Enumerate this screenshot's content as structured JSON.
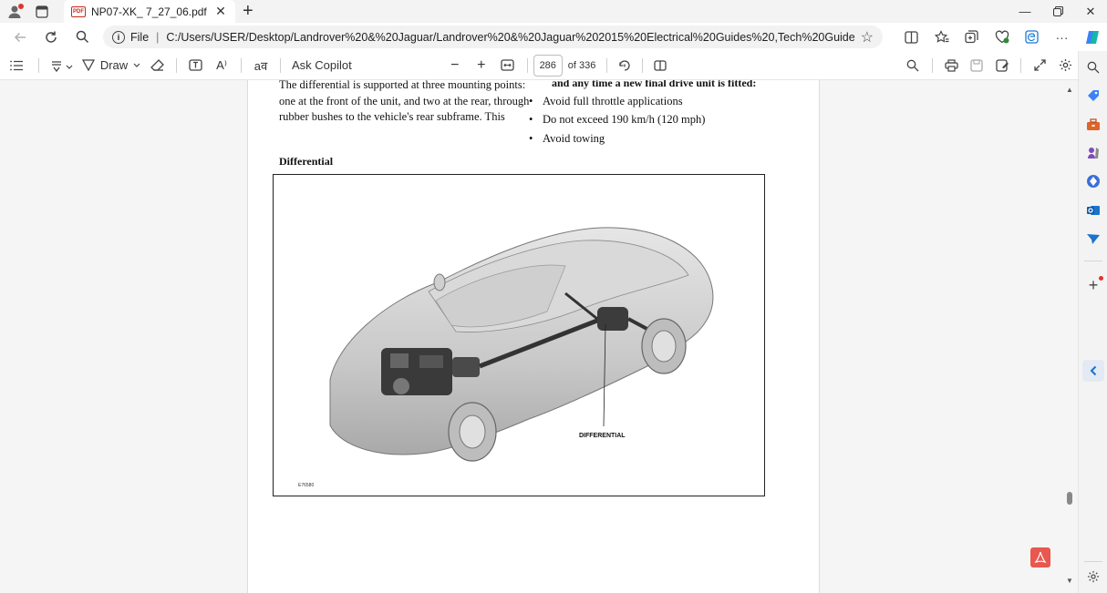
{
  "tab": {
    "title": "NP07-XK_ 7_27_06.pdf",
    "badge": "PDF"
  },
  "address": {
    "info_glyph": "i",
    "scheme_label": "File",
    "separator": "|",
    "url": "C:/Users/USER/Desktop/Landrover%20&%20Jaguar/Landrover%20&%20Jaguar%202015%20Electrical%20Guides%20,Tech%20Guides%20&%20More/L..."
  },
  "toolbar": {
    "draw_label": "Draw",
    "read_aloud_label": "A⁾",
    "translate_label": "aव",
    "copilot_label": "Ask Copilot",
    "page_number": "286",
    "page_total": "of 336"
  },
  "document": {
    "left_para": [
      "The differential is supported at three mounting points:",
      "one at the front of the unit, and two at the rear, through",
      "rubber bushes to the vehicle's rear subframe. This"
    ],
    "right_heading": "and any time a new final drive unit is fitted:",
    "bullets": [
      "Avoid full throttle applications",
      "Do not exceed 190 km/h (120 mph)",
      "Avoid towing"
    ],
    "section_heading": "Differential",
    "figure_label": "DIFFERENTIAL",
    "figure_code": "E76580"
  },
  "icons": {
    "back": "arrow-left-icon",
    "refresh": "refresh-icon",
    "search": "search-icon",
    "favorites": "star-icon",
    "settings": "gear-icon"
  },
  "colors": {
    "accent_red": "#c42b1c",
    "page_bg": "#ffffff",
    "chrome_bg": "#f3f3f3"
  }
}
